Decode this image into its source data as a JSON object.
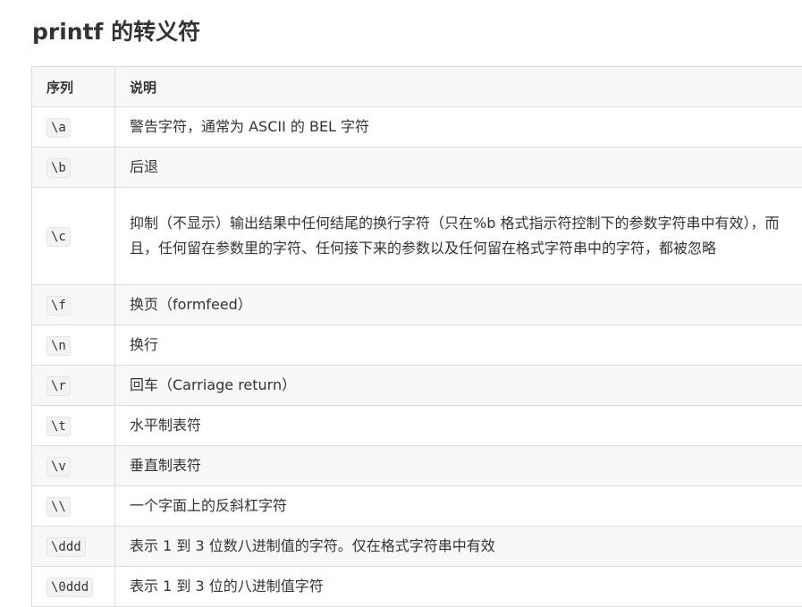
{
  "title": "printf 的转义符",
  "table": {
    "headers": {
      "sequence": "序列",
      "description": "说明"
    },
    "rows": [
      {
        "seq": "\\a",
        "desc": "警告字符，通常为 ASCII 的 BEL 字符"
      },
      {
        "seq": "\\b",
        "desc": "后退"
      },
      {
        "seq": "\\c",
        "desc": "抑制（不显示）输出结果中任何结尾的换行字符（只在%b 格式指示符控制下的参数字符串中有效），而且，任何留在参数里的字符、任何接下来的参数以及任何留在格式字符串中的字符，都被忽略"
      },
      {
        "seq": "\\f",
        "desc": "换页（formfeed）"
      },
      {
        "seq": "\\n",
        "desc": "换行"
      },
      {
        "seq": "\\r",
        "desc": "回车（Carriage return）"
      },
      {
        "seq": "\\t",
        "desc": "水平制表符"
      },
      {
        "seq": "\\v",
        "desc": "垂直制表符"
      },
      {
        "seq": "\\\\",
        "desc": "一个字面上的反斜杠字符"
      },
      {
        "seq": "\\ddd",
        "desc": "表示 1 到 3 位数八进制值的字符。仅在格式字符串中有效"
      },
      {
        "seq": "\\0ddd",
        "desc": "表示 1 到 3 位的八进制值字符"
      }
    ]
  }
}
